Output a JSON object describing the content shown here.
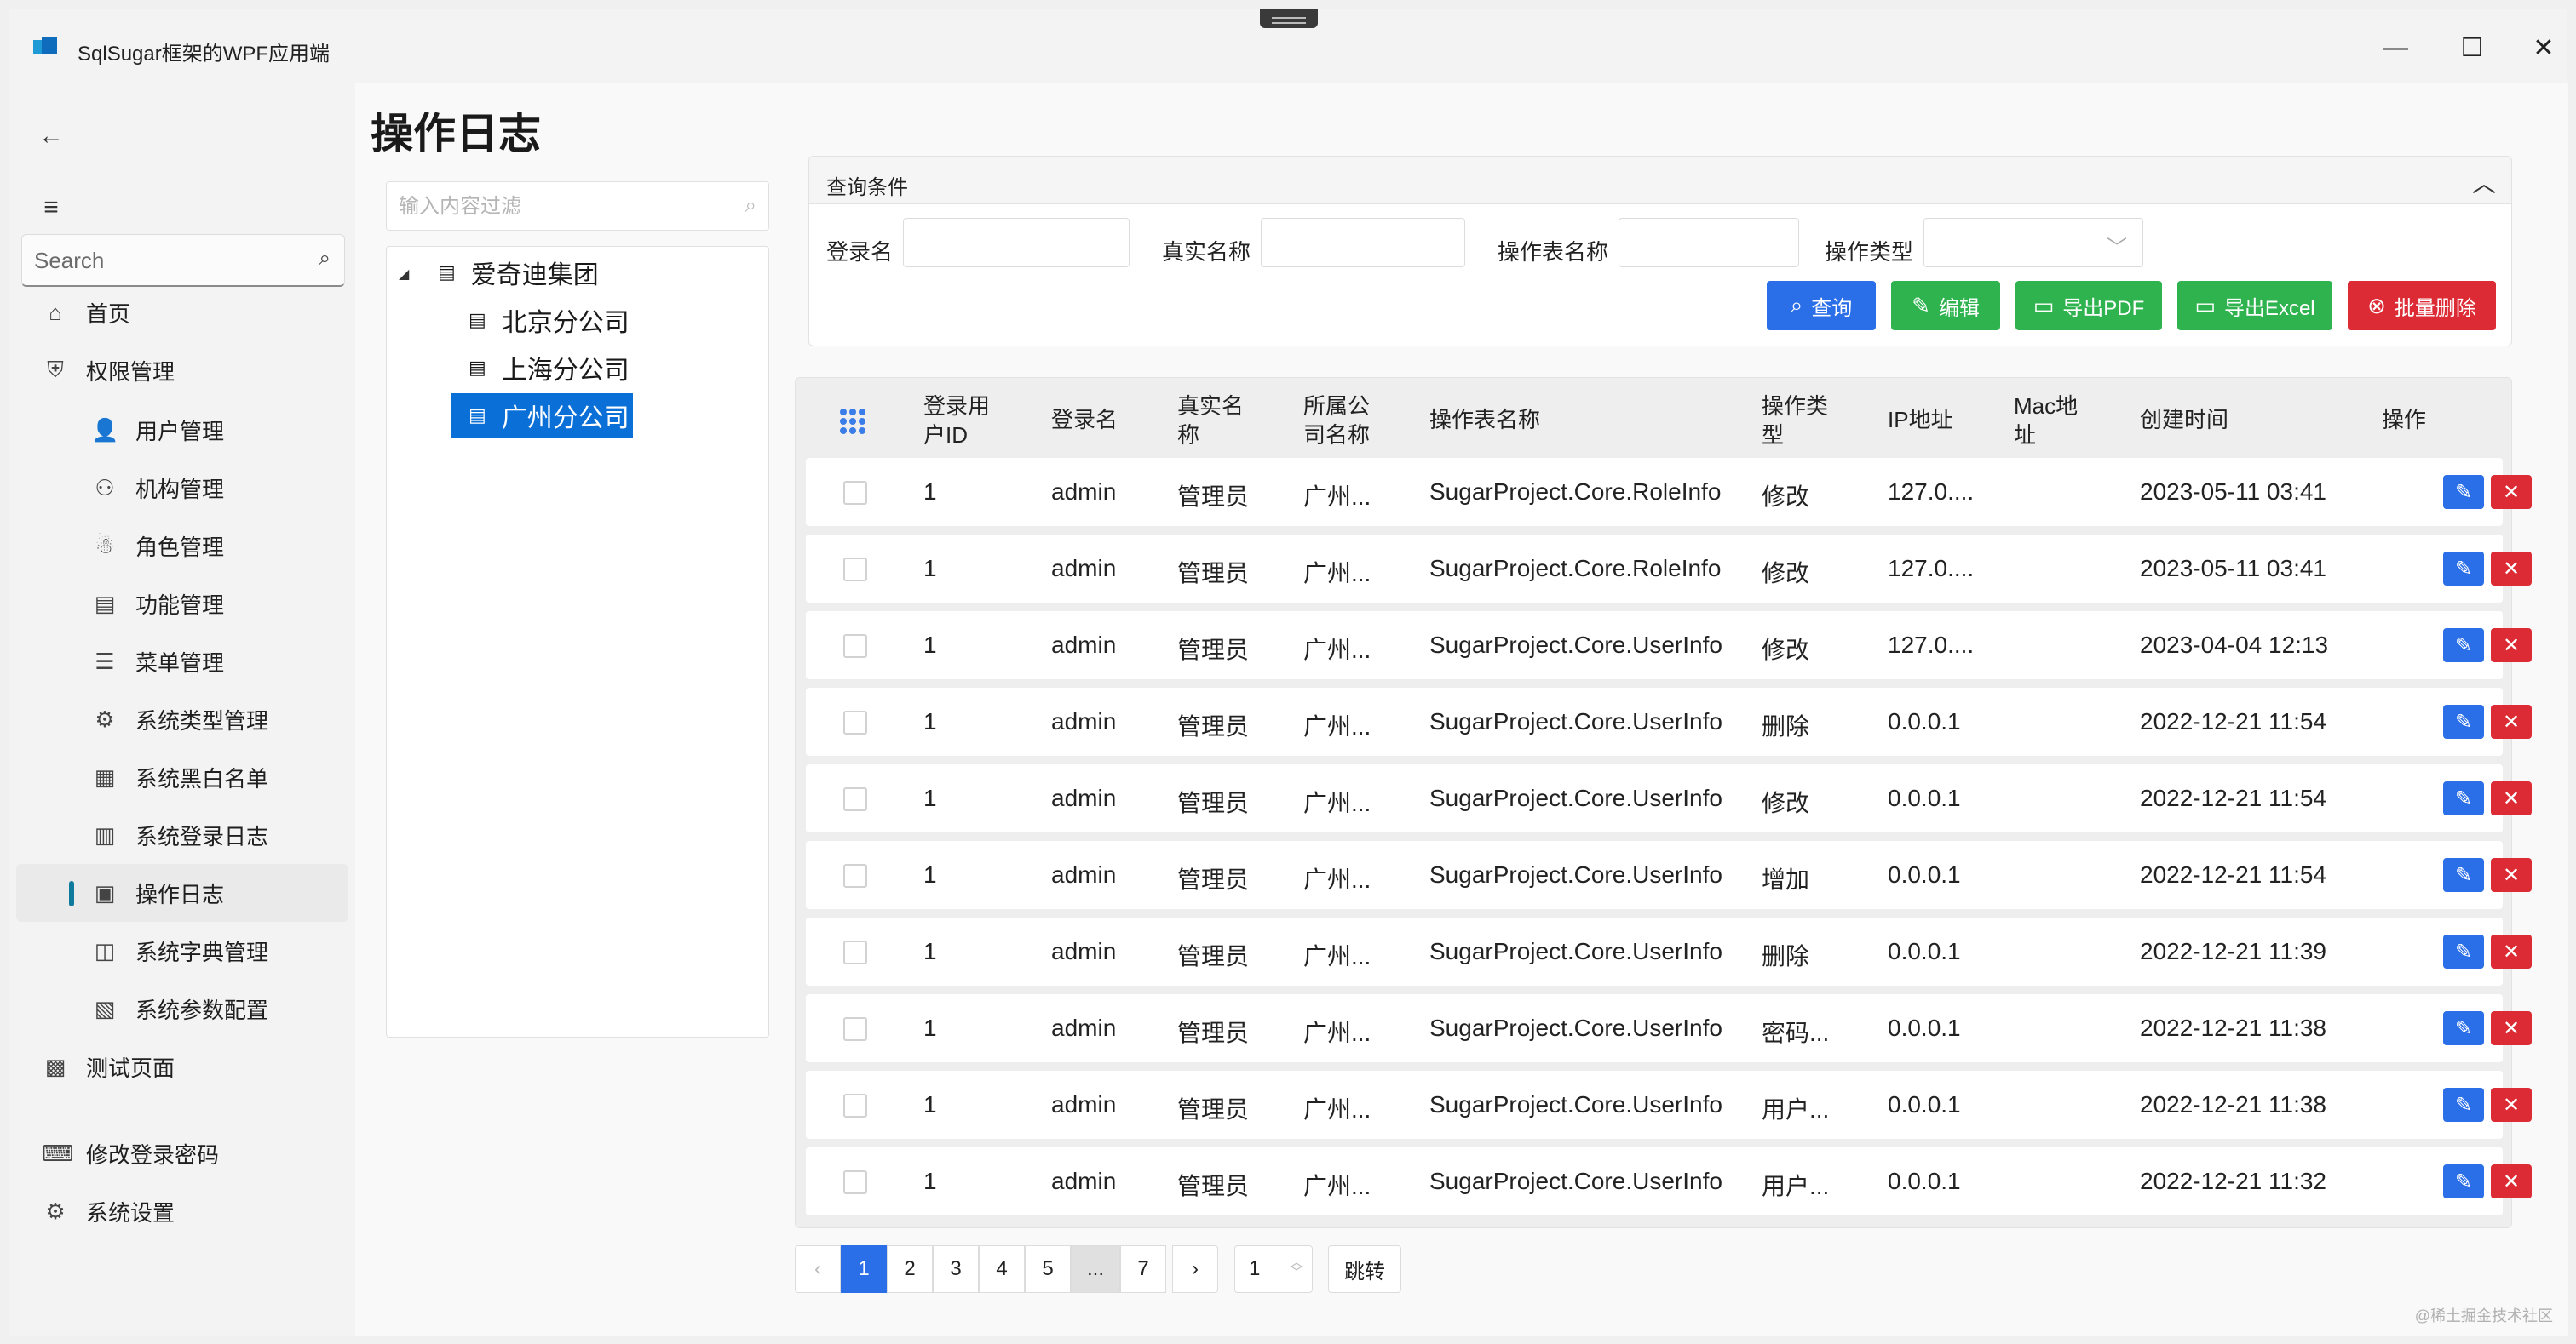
{
  "window": {
    "title": "SqlSugar框架的WPF应用端",
    "minimize_icon": "minimize-icon",
    "maximize_icon": "maximize-icon",
    "close_icon": "close-icon"
  },
  "sidebar": {
    "search_placeholder": "Search",
    "items": [
      {
        "label": "首页",
        "icon": "home-icon",
        "glyph": "⌂",
        "level": "top"
      },
      {
        "label": "权限管理",
        "icon": "shield-icon",
        "glyph": "⛨",
        "level": "top"
      },
      {
        "label": "用户管理",
        "icon": "user-icon",
        "glyph": "👤",
        "level": "sub"
      },
      {
        "label": "机构管理",
        "icon": "org-icon",
        "glyph": "⚇",
        "level": "sub"
      },
      {
        "label": "角色管理",
        "icon": "role-icon",
        "glyph": "☃",
        "level": "sub"
      },
      {
        "label": "功能管理",
        "icon": "clipboard-icon",
        "glyph": "▤",
        "level": "sub"
      },
      {
        "label": "菜单管理",
        "icon": "menu-list-icon",
        "glyph": "☰",
        "level": "sub"
      },
      {
        "label": "系统类型管理",
        "icon": "type-icon",
        "glyph": "⚙",
        "level": "sub"
      },
      {
        "label": "系统黑白名单",
        "icon": "list-lock-icon",
        "glyph": "▦",
        "level": "sub"
      },
      {
        "label": "系统登录日志",
        "icon": "login-log-icon",
        "glyph": "▥",
        "level": "sub"
      },
      {
        "label": "操作日志",
        "icon": "operation-log-icon",
        "glyph": "▣",
        "level": "sub",
        "active": true
      },
      {
        "label": "系统字典管理",
        "icon": "dictionary-icon",
        "glyph": "◫",
        "level": "sub"
      },
      {
        "label": "系统参数配置",
        "icon": "config-icon",
        "glyph": "▧",
        "level": "sub"
      },
      {
        "label": "测试页面",
        "icon": "test-page-icon",
        "glyph": "▩",
        "level": "top"
      }
    ],
    "footer": [
      {
        "label": "修改登录密码",
        "icon": "keyboard-icon",
        "glyph": "⌨"
      },
      {
        "label": "系统设置",
        "icon": "gear-icon",
        "glyph": "⚙"
      }
    ]
  },
  "main": {
    "title": "操作日志",
    "tree": {
      "filter_placeholder": "输入内容过滤",
      "root": "爱奇迪集团",
      "children": [
        "北京分公司",
        "上海分公司",
        "广州分公司"
      ],
      "selected": "广州分公司"
    },
    "query": {
      "header": "查询条件",
      "fields": [
        {
          "label": "登录名",
          "value": ""
        },
        {
          "label": "真实名称",
          "value": ""
        },
        {
          "label": "操作表名称",
          "value": ""
        },
        {
          "label": "操作类型",
          "value": ""
        }
      ],
      "buttons": {
        "search": "查询",
        "edit": "编辑",
        "export_pdf": "导出PDF",
        "export_excel": "导出Excel",
        "batch_delete": "批量删除"
      }
    },
    "table": {
      "headers": [
        "登录用\n户ID",
        "登录名",
        "真实名\n称",
        "所属公\n司名称",
        "操作表名称",
        "操作类\n型",
        "IP地址",
        "Mac地\n址",
        "创建时间",
        "操作"
      ],
      "rows": [
        {
          "uid": "1",
          "login": "admin",
          "real": "管理员",
          "company": "广州...",
          "table": "SugarProject.Core.RoleInfo",
          "op": "修改",
          "ip": "127.0....",
          "mac": "",
          "time": "2023-05-11 03:41"
        },
        {
          "uid": "1",
          "login": "admin",
          "real": "管理员",
          "company": "广州...",
          "table": "SugarProject.Core.RoleInfo",
          "op": "修改",
          "ip": "127.0....",
          "mac": "",
          "time": "2023-05-11 03:41"
        },
        {
          "uid": "1",
          "login": "admin",
          "real": "管理员",
          "company": "广州...",
          "table": "SugarProject.Core.UserInfo",
          "op": "修改",
          "ip": "127.0....",
          "mac": "",
          "time": "2023-04-04 12:13"
        },
        {
          "uid": "1",
          "login": "admin",
          "real": "管理员",
          "company": "广州...",
          "table": "SugarProject.Core.UserInfo",
          "op": "删除",
          "ip": "0.0.0.1",
          "mac": "",
          "time": "2022-12-21 11:54"
        },
        {
          "uid": "1",
          "login": "admin",
          "real": "管理员",
          "company": "广州...",
          "table": "SugarProject.Core.UserInfo",
          "op": "修改",
          "ip": "0.0.0.1",
          "mac": "",
          "time": "2022-12-21 11:54"
        },
        {
          "uid": "1",
          "login": "admin",
          "real": "管理员",
          "company": "广州...",
          "table": "SugarProject.Core.UserInfo",
          "op": "增加",
          "ip": "0.0.0.1",
          "mac": "",
          "time": "2022-12-21 11:54"
        },
        {
          "uid": "1",
          "login": "admin",
          "real": "管理员",
          "company": "广州...",
          "table": "SugarProject.Core.UserInfo",
          "op": "删除",
          "ip": "0.0.0.1",
          "mac": "",
          "time": "2022-12-21 11:39"
        },
        {
          "uid": "1",
          "login": "admin",
          "real": "管理员",
          "company": "广州...",
          "table": "SugarProject.Core.UserInfo",
          "op": "密码...",
          "ip": "0.0.0.1",
          "mac": "",
          "time": "2022-12-21 11:38"
        },
        {
          "uid": "1",
          "login": "admin",
          "real": "管理员",
          "company": "广州...",
          "table": "SugarProject.Core.UserInfo",
          "op": "用户...",
          "ip": "0.0.0.1",
          "mac": "",
          "time": "2022-12-21 11:38"
        },
        {
          "uid": "1",
          "login": "admin",
          "real": "管理员",
          "company": "广州...",
          "table": "SugarProject.Core.UserInfo",
          "op": "用户...",
          "ip": "0.0.0.1",
          "mac": "",
          "time": "2022-12-21 11:32"
        }
      ]
    },
    "pager": {
      "pages": [
        "1",
        "2",
        "3",
        "4",
        "5",
        "...",
        "7"
      ],
      "current": "1",
      "jump_value": "1",
      "jump_label": "跳转"
    }
  },
  "watermark": "@稀土掘金技术社区",
  "colors": {
    "accent": "#2a6ee8",
    "success": "#2fb34f",
    "danger": "#dc2b34",
    "tree_selected": "#0a6fd6"
  }
}
